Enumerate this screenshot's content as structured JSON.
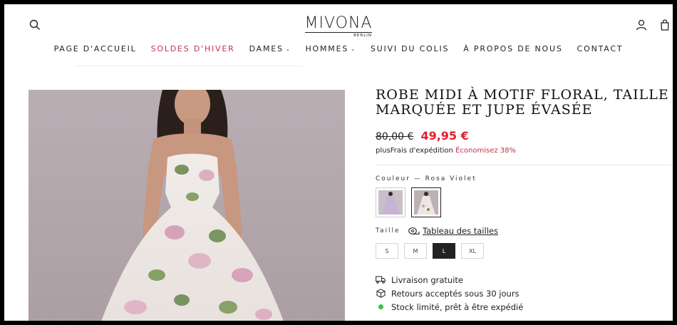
{
  "header": {
    "logo_main": "MIVONA",
    "logo_sub": "BERLIN",
    "search_icon": "search-icon",
    "account_icon": "user-icon",
    "cart_icon": "cart-icon"
  },
  "nav": [
    {
      "label": "PAGE D'ACCUEIL"
    },
    {
      "label": "SOLDES D'HIVER"
    },
    {
      "label": "DAMES"
    },
    {
      "label": "HOMMES"
    },
    {
      "label": "SUIVI DU COLIS"
    },
    {
      "label": "À PROPOS DE NOUS"
    },
    {
      "label": "CONTACT"
    }
  ],
  "product": {
    "title": "ROBE MIDI À MOTIF FLORAL, TAILLE MARQUÉE ET JUPE ÉVASÉE",
    "old_price": "80,00 €",
    "new_price": "49,95 €",
    "ship_plus": "plus",
    "ship_link": "Frais d'expédition",
    "savings": "Économisez 38%",
    "color_label": "Couleur — Rosa Violet",
    "size_label": "Taille",
    "size_chart": "Tableau des tailles",
    "sizes": [
      "S",
      "M",
      "L",
      "XL"
    ],
    "selected_size": "L",
    "features": [
      {
        "icon": "truck-icon",
        "text": "Livraison gratuite"
      },
      {
        "icon": "box-return-icon",
        "text": "Retours acceptés sous 30 jours"
      },
      {
        "icon": "status-dot-icon",
        "text": "Stock limité, prêt à être expédié"
      }
    ]
  },
  "colors": {
    "sale": "#c2334d",
    "price": "#e01e2d",
    "stock_dot": "#3cc24a"
  }
}
